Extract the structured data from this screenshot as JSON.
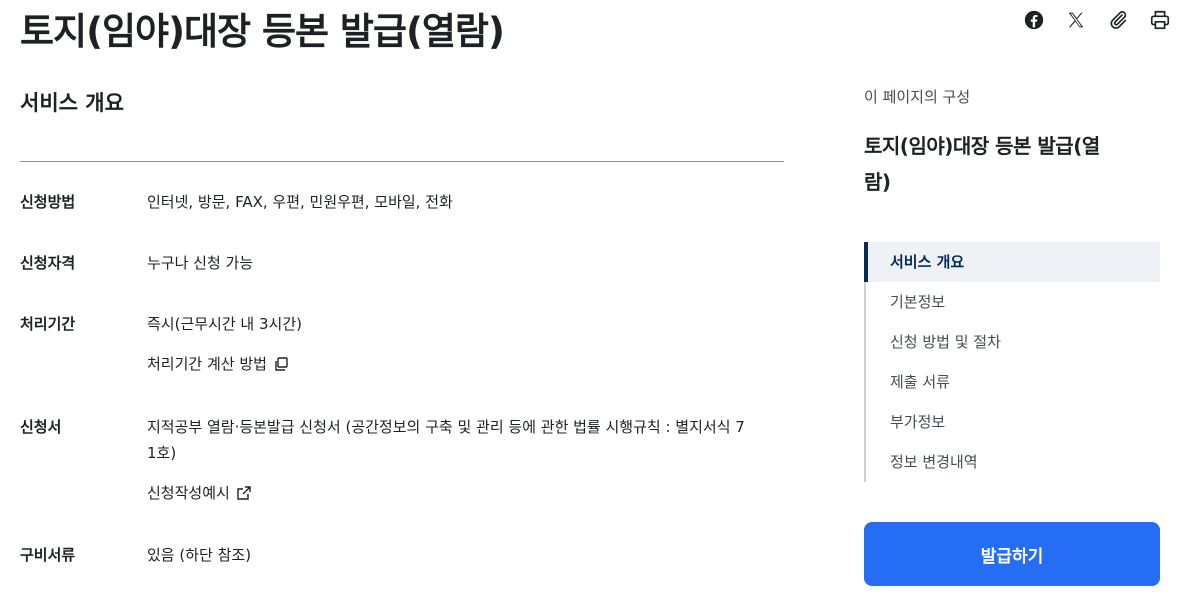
{
  "page": {
    "title": "토지(임야)대장 등본 발급(열람)"
  },
  "share": [
    {
      "icon": "facebook-icon"
    },
    {
      "icon": "x-twitter-icon"
    },
    {
      "icon": "paperclip-icon"
    },
    {
      "icon": "print-icon"
    }
  ],
  "overview": {
    "title": "서비스 개요",
    "rows": [
      {
        "label": "신청방법",
        "value": "인터넷, 방문, FAX, 우편, 민원우편, 모바일, 전화"
      },
      {
        "label": "신청자격",
        "value": "누구나 신청 가능"
      },
      {
        "label": "처리기간",
        "value": "즉시(근무시간 내 3시간)",
        "sub": "처리기간 계산 방법",
        "sub_icon": "copy-icon"
      },
      {
        "label": "신청서",
        "value": "지적공부 열람·등본발급 신청서 (공간정보의 구축 및 관리 등에 관한 법률 시행규칙 : 별지서식 7 1호)",
        "value_line1": "지적공부 열람·등본발급 신청서 (공간정보의 구축 및 관리 등에 관한 법률 시행규칙 : 별지서식 7",
        "value_line2": "1호)",
        "sub": "신청작성예시",
        "sub_icon": "external-link-icon"
      },
      {
        "label": "구비서류",
        "value": "있음 (하단 참조)"
      }
    ]
  },
  "toc": {
    "caption": "이 페이지의 구성",
    "heading_line1": "토지(임야)대장 등본 발급(열",
    "heading_line2": "람)",
    "items": [
      {
        "label": "서비스 개요",
        "active": true
      },
      {
        "label": "기본정보",
        "active": false
      },
      {
        "label": "신청 방법 및 절차",
        "active": false
      },
      {
        "label": "제출 서류",
        "active": false
      },
      {
        "label": "부가정보",
        "active": false
      },
      {
        "label": "정보 변경내역",
        "active": false
      }
    ]
  },
  "action": {
    "apply_label": "발급하기",
    "accent_color": "#256ef4"
  }
}
